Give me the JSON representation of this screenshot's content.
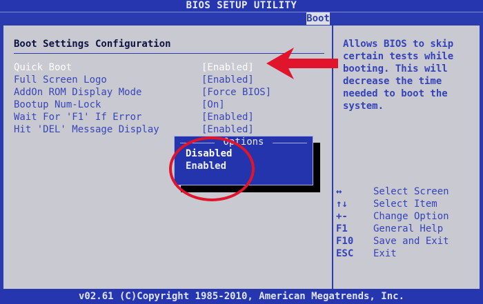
{
  "window": {
    "title": "BIOS SETUP UTILITY",
    "active_tab": "Boot"
  },
  "section": {
    "title": "Boot Settings Configuration"
  },
  "settings": [
    {
      "label": "Quick Boot",
      "value": "[Enabled]"
    },
    {
      "label": "Full Screen Logo",
      "value": "[Enabled]"
    },
    {
      "label": "AddOn ROM Display Mode",
      "value": "[Force BIOS]"
    },
    {
      "label": "Bootup Num-Lock",
      "value": "[On]"
    },
    {
      "label": "Wait For 'F1' If Error",
      "value": "[Enabled]"
    },
    {
      "label": "Hit 'DEL' Message Display",
      "value": "[Enabled]"
    }
  ],
  "help": {
    "text": "Allows BIOS to skip\ncertain tests while\nbooting. This will\ndecrease the time\nneeded to boot the\nsystem."
  },
  "keys": [
    {
      "key": "↔",
      "action": "Select Screen"
    },
    {
      "key": "↑↓",
      "action": "Select Item"
    },
    {
      "key": "+-",
      "action": "Change Option"
    },
    {
      "key": "F1",
      "action": "General Help"
    },
    {
      "key": "F10",
      "action": "Save and Exit"
    },
    {
      "key": "ESC",
      "action": "Exit"
    }
  ],
  "popup": {
    "title": "Options",
    "options": [
      "Disabled",
      "Enabled"
    ],
    "selected": "Disabled"
  },
  "footer": {
    "text": "v02.61 (C)Copyright 1985-2010, American Megatrends, Inc."
  },
  "colors": {
    "bios_blue": "#2a3bb0",
    "panel_gray": "#c9cad1",
    "annotation_red": "#e0142a"
  }
}
